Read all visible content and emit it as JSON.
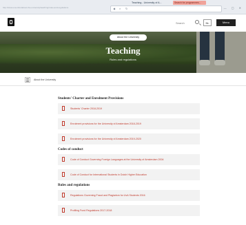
{
  "browser": {
    "url": "http://www.uva.nl/en/about-the-university/teaching/rules-and-regulations",
    "tabs": [
      {
        "title": "Teaching - University of A..."
      },
      {
        "title": "Search for programmes..."
      }
    ]
  },
  "header": {
    "search_label": "Search",
    "lang_label": "NL",
    "menu_label": "Menu"
  },
  "hero": {
    "pill_label": "About the University",
    "title": "Teaching",
    "subtitle": "Rules and regulations"
  },
  "subnav": {
    "label": "About the University"
  },
  "sections": [
    {
      "heading": "Students' Charter and Enrolment Provisions",
      "items": [
        {
          "label": "Students' Charter 2018-2019"
        },
        {
          "label": "Enrolment provisions for the University of Amsterdam 2018-2019"
        },
        {
          "label": "Enrolment provisions for the University of Amsterdam 2019-2020"
        }
      ]
    },
    {
      "heading": "Codes of conduct",
      "items": [
        {
          "label": "Code of Conduct Governing Foreign Languages at the University of Amsterdam 2004"
        },
        {
          "label": "Code of Conduct for International Students in Dutch Higher Education"
        }
      ]
    },
    {
      "heading": "Rules and regulations",
      "items": [
        {
          "label": "Regulations Governing Fraud and Plagiarism for UvA Students 2016"
        },
        {
          "label": "Profiling Fund Regulations 2017-2018"
        }
      ]
    }
  ],
  "colors": {
    "accent": "#c0392b",
    "row_bg": "#f2f2f2",
    "menu_bg": "#222222"
  }
}
